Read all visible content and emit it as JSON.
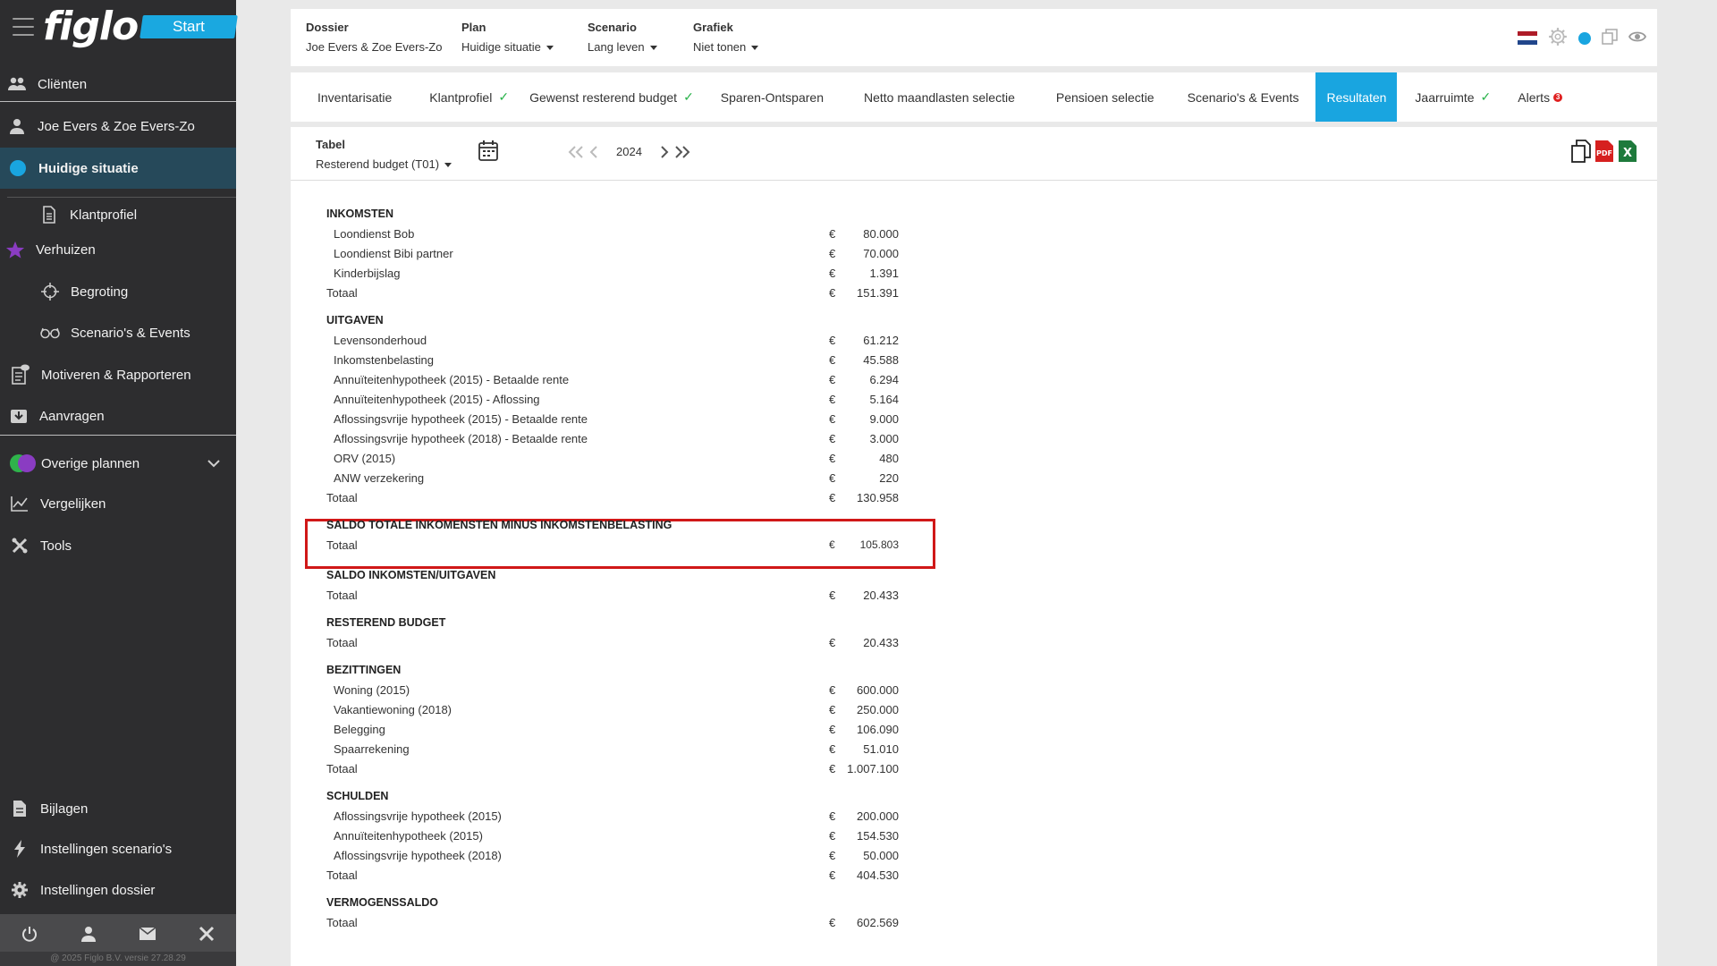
{
  "sidebar": {
    "logo": "figlo",
    "start_label": "Start",
    "items": [
      {
        "label": "Cliënten",
        "icon": "users-icon"
      },
      {
        "label": "Joe Evers & Zoe Evers-Zo",
        "icon": "user-icon"
      },
      {
        "label": "Huidige situatie",
        "icon": "blue-dot-icon"
      },
      {
        "label": "Klantprofiel",
        "icon": "document-icon"
      },
      {
        "label": "Verhuizen",
        "icon": "star-icon"
      },
      {
        "label": "Begroting",
        "icon": "crosshair-icon"
      },
      {
        "label": "Scenario's & Events",
        "icon": "glasses-icon"
      },
      {
        "label": "Motiveren & Rapporteren",
        "icon": "report-icon"
      },
      {
        "label": "Aanvragen",
        "icon": "inbox-icon"
      },
      {
        "label": "Overige plannen",
        "icon": "plans-icon"
      },
      {
        "label": "Vergelijken",
        "icon": "chart-line-icon"
      },
      {
        "label": "Tools",
        "icon": "tools-icon"
      },
      {
        "label": "Bijlagen",
        "icon": "file-icon"
      },
      {
        "label": "Instellingen scenario's",
        "icon": "bolt-icon"
      },
      {
        "label": "Instellingen dossier",
        "icon": "gear-icon"
      }
    ],
    "footer": "@ 2025 Figlo B.V. versie 27.28.29"
  },
  "topbar": {
    "dossier_title": "Dossier",
    "dossier_value": "Joe Evers & Zoe Evers-Zo",
    "plan_title": "Plan",
    "plan_value": "Huidige situatie",
    "scenario_title": "Scenario",
    "scenario_value": "Lang leven",
    "grafiek_title": "Grafiek",
    "grafiek_value": "Niet tonen"
  },
  "tabs": [
    {
      "label": "Inventarisatie",
      "check": false
    },
    {
      "label": "Klantprofiel",
      "check": true
    },
    {
      "label": "Gewenst resterend budget",
      "check": true
    },
    {
      "label": "Sparen-Ontsparen",
      "check": false
    },
    {
      "label": "Netto maandlasten selectie",
      "check": false
    },
    {
      "label": "Pensioen selectie",
      "check": false
    },
    {
      "label": "Scenario's & Events",
      "check": false
    },
    {
      "label": "Resultaten",
      "check": false,
      "active": true
    },
    {
      "label": "Jaarruimte",
      "check": true
    },
    {
      "label": "Alerts",
      "alert_count": "3"
    }
  ],
  "toolbar": {
    "tabel_title": "Tabel",
    "tabel_value": "Resterend budget (T01)",
    "year": "2024"
  },
  "table": {
    "currency": "€",
    "inkomsten": {
      "title": "INKOMSTEN",
      "rows": [
        {
          "label": "Loondienst Bob",
          "amount": "80.000"
        },
        {
          "label": "Loondienst Bibi partner",
          "amount": "70.000"
        },
        {
          "label": "Kinderbijslag",
          "amount": "1.391"
        }
      ],
      "total_label": "Totaal",
      "total": "151.391"
    },
    "uitgaven": {
      "title": "UITGAVEN",
      "rows": [
        {
          "label": "Levensonderhoud",
          "amount": "61.212"
        },
        {
          "label": "Inkomstenbelasting",
          "amount": "45.588"
        },
        {
          "label": "Annuïteitenhypotheek (2015) - Betaalde rente",
          "amount": "6.294"
        },
        {
          "label": "Annuïteitenhypotheek (2015) - Aflossing",
          "amount": "5.164"
        },
        {
          "label": "Aflossingsvrije hypotheek (2015) - Betaalde rente",
          "amount": "9.000"
        },
        {
          "label": "Aflossingsvrije hypotheek (2018) - Betaalde rente",
          "amount": "3.000"
        },
        {
          "label": "ORV (2015)",
          "amount": "480"
        },
        {
          "label": "ANW verzekering",
          "amount": "220"
        }
      ],
      "total_label": "Totaal",
      "total": "130.958"
    },
    "saldo_belasting": {
      "title": "SALDO TOTALE INKOMENSTEN MINUS INKOMSTENBELASTING",
      "total_label": "Totaal",
      "total": "105.803"
    },
    "saldo_iu": {
      "title": "SALDO INKOMSTEN/UITGAVEN",
      "total_label": "Totaal",
      "total": "20.433"
    },
    "resterend": {
      "title": "RESTEREND BUDGET",
      "total_label": "Totaal",
      "total": "20.433"
    },
    "bezittingen": {
      "title": "BEZITTINGEN",
      "rows": [
        {
          "label": "Woning (2015)",
          "amount": "600.000"
        },
        {
          "label": "Vakantiewoning (2018)",
          "amount": "250.000"
        },
        {
          "label": "Belegging",
          "amount": "106.090"
        },
        {
          "label": "Spaarrekening",
          "amount": "51.010"
        }
      ],
      "total_label": "Totaal",
      "total": "1.007.100"
    },
    "schulden": {
      "title": "SCHULDEN",
      "rows": [
        {
          "label": "Aflossingsvrije hypotheek (2015)",
          "amount": "200.000"
        },
        {
          "label": "Annuïteitenhypotheek (2015)",
          "amount": "154.530"
        },
        {
          "label": "Aflossingsvrije hypotheek (2018)",
          "amount": "50.000"
        }
      ],
      "total_label": "Totaal",
      "total": "404.530"
    },
    "vermogen": {
      "title": "VERMOGENSSALDO",
      "total_label": "Totaal",
      "total": "602.569"
    }
  },
  "colors": {
    "accent": "#19a5e0",
    "sidebar_bg": "#2d2d2f",
    "active_item_bg": "#26495a",
    "highlight_border": "#d01818",
    "check_green": "#2ab34b"
  }
}
